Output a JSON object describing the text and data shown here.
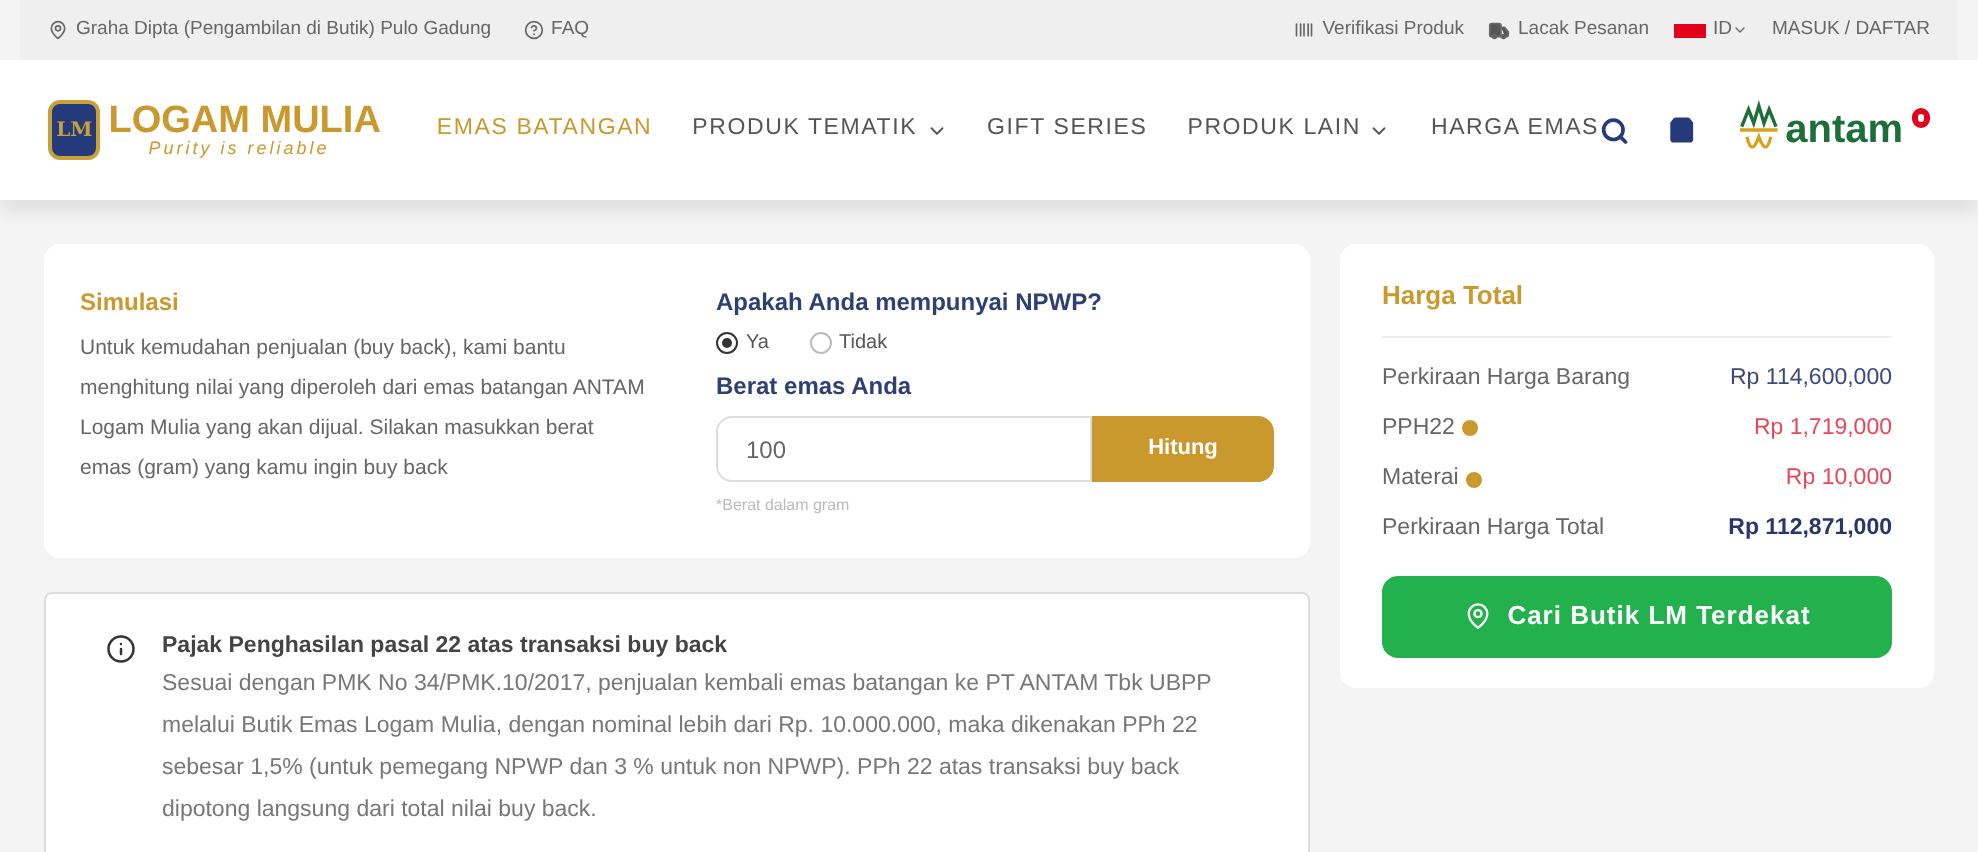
{
  "topbar": {
    "location": "Graha Dipta (Pengambilan di Butik) Pulo Gadung",
    "faq": "FAQ",
    "verify": "Verifikasi Produk",
    "track": "Lacak Pesanan",
    "language": "ID",
    "login": "MASUK / DAFTAR"
  },
  "logo": {
    "name": "LOGAM MULIA",
    "tagline": "Purity is reliable",
    "badge": "LM"
  },
  "nav": [
    {
      "label": "EMAS BATANGAN",
      "selected": true,
      "dropdown": false
    },
    {
      "label": "PRODUK TEMATIK",
      "selected": false,
      "dropdown": true
    },
    {
      "label": "GIFT SERIES",
      "selected": false,
      "dropdown": false
    },
    {
      "label": "PRODUK LAIN",
      "selected": false,
      "dropdown": true
    },
    {
      "label": "HARGA EMAS",
      "selected": false,
      "dropdown": false
    }
  ],
  "partner_logo": "antam",
  "simulation": {
    "title": "Simulasi",
    "description": "Untuk kemudahan penjualan (buy back), kami bantu menghitung nilai yang diperoleh dari emas batangan ANTAM Logam Mulia yang akan dijual. Silakan masukkan berat emas (gram) yang kamu ingin buy back",
    "question": "Apakah Anda mempunyai NPWP?",
    "options": [
      {
        "label": "Ya",
        "selected": true
      },
      {
        "label": "Tidak",
        "selected": false
      }
    ],
    "weight_label": "Berat emas Anda",
    "weight_value": "100",
    "button": "Hitung",
    "hint": "*Berat dalam gram"
  },
  "total": {
    "title": "Harga Total",
    "rows": [
      {
        "label": "Perkiraan Harga Barang",
        "value": "Rp 114,600,000",
        "kind": "price",
        "info": false
      },
      {
        "label": "PPH22",
        "value": "Rp 1,719,000",
        "kind": "deduction",
        "info": true
      },
      {
        "label": "Materai",
        "value": "Rp 10,000",
        "kind": "deduction",
        "info": true
      },
      {
        "label": "Perkiraan Harga Total",
        "value": "Rp 112,871,000",
        "kind": "total",
        "info": false
      }
    ],
    "button": "Cari Butik LM Terdekat"
  },
  "notice": {
    "title": "Pajak Penghasilan pasal 22 atas transaksi buy back",
    "body": "Sesuai dengan PMK No 34/PMK.10/2017, penjualan kembali emas batangan ke PT ANTAM Tbk UBPP melalui Butik Emas Logam Mulia, dengan nominal lebih dari Rp. 10.000.000, maka dikenakan PPh 22 sebesar 1,5% (untuk pemegang NPWP dan 3 % untuk non NPWP). PPh 22 atas transaksi buy back dipotong langsung dari total nilai buy back."
  }
}
